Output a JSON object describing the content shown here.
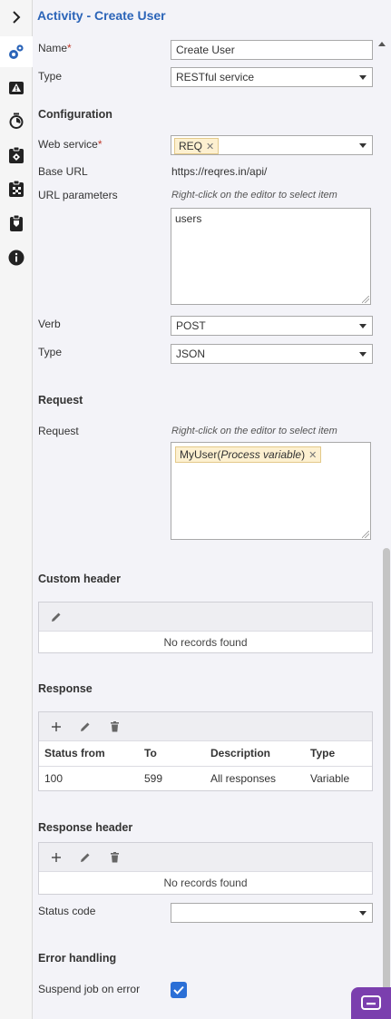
{
  "header": {
    "title": "Activity - Create User"
  },
  "rail": {
    "toggle_icon": "chevron-right-icon",
    "icons": [
      "gears-icon",
      "warning-icon",
      "timer-icon",
      "clipboard-settings-icon",
      "flag-checkered-icon",
      "clipboard-check-icon",
      "info-icon"
    ]
  },
  "form": {
    "name_label": "Name",
    "name_required": "*",
    "name_value": "Create User",
    "type_label": "Type",
    "type_value": "RESTful service",
    "configuration_heading": "Configuration",
    "web_service_label": "Web service",
    "web_service_required": "*",
    "web_service_chip": "REQ",
    "base_url_label": "Base URL",
    "base_url_value": "https://reqres.in/api/",
    "url_params_label": "URL parameters",
    "url_params_hint": "Right-click on the editor to select item",
    "url_params_value": "users",
    "verb_label": "Verb",
    "verb_value": "POST",
    "type2_label": "Type",
    "type2_value": "JSON",
    "request_heading": "Request",
    "request_label": "Request",
    "request_hint": "Right-click on the editor to select item",
    "request_chip_name": "MyUser",
    "request_chip_open": " (",
    "request_chip_kind": "Process variable",
    "request_chip_close": ")",
    "custom_header_heading": "Custom header",
    "custom_header_empty": "No records found",
    "response_heading": "Response",
    "response_columns": [
      "Status from",
      "To",
      "Description",
      "Type"
    ],
    "response_rows": [
      {
        "from": "100",
        "to": "599",
        "description": "All responses",
        "type": "Variable"
      }
    ],
    "response_header_heading": "Response header",
    "response_header_empty": "No records found",
    "status_code_label": "Status code",
    "status_code_value": "",
    "error_handling_heading": "Error handling",
    "suspend_label": "Suspend job on error",
    "suspend_checked": true
  },
  "colors": {
    "accent": "#2b64b8",
    "checkbox": "#2b6fd6",
    "chip_bg": "#fdf0d0",
    "fab": "#7b3fae"
  }
}
